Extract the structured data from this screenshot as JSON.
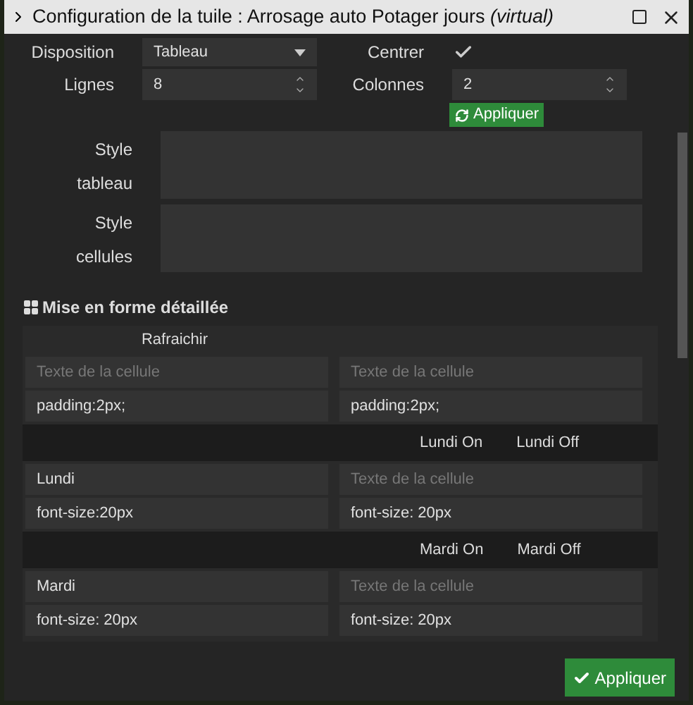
{
  "window": {
    "title": "Configuration de la tuile : Arrosage auto Potager jours *(virtual)*"
  },
  "form": {
    "disposition": {
      "label": "Disposition",
      "value": "Tableau"
    },
    "centrer": {
      "label": "Centrer",
      "checked": true
    },
    "lignes": {
      "label": "Lignes",
      "value": "8"
    },
    "colonnes": {
      "label": "Colonnes",
      "value": "2"
    },
    "apply_small": "Appliquer",
    "style_tableau": {
      "label_lines": [
        "Style",
        "tableau"
      ]
    },
    "style_cellules": {
      "label_lines": [
        "Style",
        "cellules"
      ]
    }
  },
  "section": {
    "title": "Mise en forme détaillée",
    "groups": [
      {
        "kind": "refresh",
        "labels": [
          "Rafraichir"
        ],
        "cells": [
          {
            "placeholder": "Texte de la cellule",
            "style": "padding:2px;"
          },
          {
            "placeholder": "Texte de la cellule",
            "style": "padding:2px;"
          }
        ]
      },
      {
        "kind": "header",
        "labels": [
          "Lundi On",
          "Lundi Off"
        ],
        "cells": [
          {
            "text": "Lundi",
            "style": "font-size:20px"
          },
          {
            "placeholder": "Texte de la cellule",
            "style": "font-size: 20px"
          }
        ]
      },
      {
        "kind": "header",
        "labels": [
          "Mardi On",
          "Mardi Off"
        ],
        "cells": [
          {
            "text": "Mardi",
            "style": "font-size: 20px"
          },
          {
            "placeholder": "Texte de la cellule",
            "style": "font-size: 20px"
          }
        ]
      }
    ]
  },
  "footer": {
    "apply": "Appliquer"
  }
}
